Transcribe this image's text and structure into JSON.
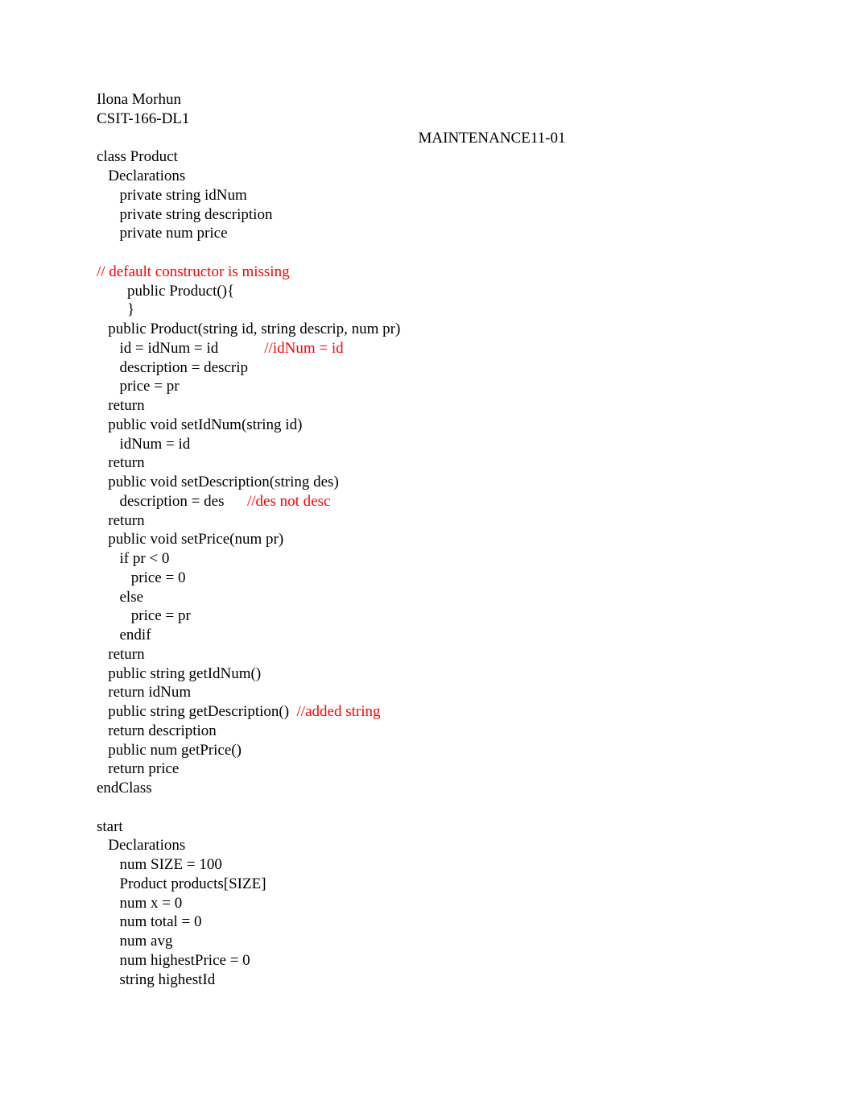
{
  "header": {
    "author": "Ilona Morhun",
    "course": "CSIT-166-DL1",
    "title": "MAINTENANCE11-01"
  },
  "lines": {
    "l1": "class Product",
    "l2": "   Declarations",
    "l3": "      private string idNum",
    "l4": "      private string description",
    "l5": "      private num price",
    "c1": "// default constructor is missing",
    "l6": "        public Product(){",
    "l7": "        }",
    "l8": "   public Product(string id, string descrip, num pr)",
    "l9a": "      id = idNum = id            ",
    "l9b": "//idNum = id",
    "l10": "      description = descrip",
    "l11": "      price = pr",
    "l12": "   return",
    "l13": "   public void setIdNum(string id)",
    "l14": "      idNum = id",
    "l15": "   return",
    "l16": "   public void setDescription(string des)",
    "l17a": "      description = des      ",
    "l17b": "//des not desc",
    "l18": "   return",
    "l19": "   public void setPrice(num pr)",
    "l20": "      if pr < 0",
    "l21": "         price = 0",
    "l22": "      else",
    "l23": "         price = pr",
    "l24": "      endif",
    "l25": "   return",
    "l26": "   public string getIdNum()",
    "l27": "   return idNum",
    "l28a": "   public string getDescription()  ",
    "l28b": "//added string",
    "l29": "   return description",
    "l30": "   public num getPrice()",
    "l31": "   return price",
    "l32": "endClass",
    "s1": "start",
    "s2": "   Declarations",
    "s3": "      num SIZE = 100",
    "s4": "      Product products[SIZE]",
    "s5": "      num x = 0",
    "s6": "      num total = 0",
    "s7": "      num avg",
    "s8": "      num highestPrice = 0",
    "s9": "      string highestId"
  }
}
